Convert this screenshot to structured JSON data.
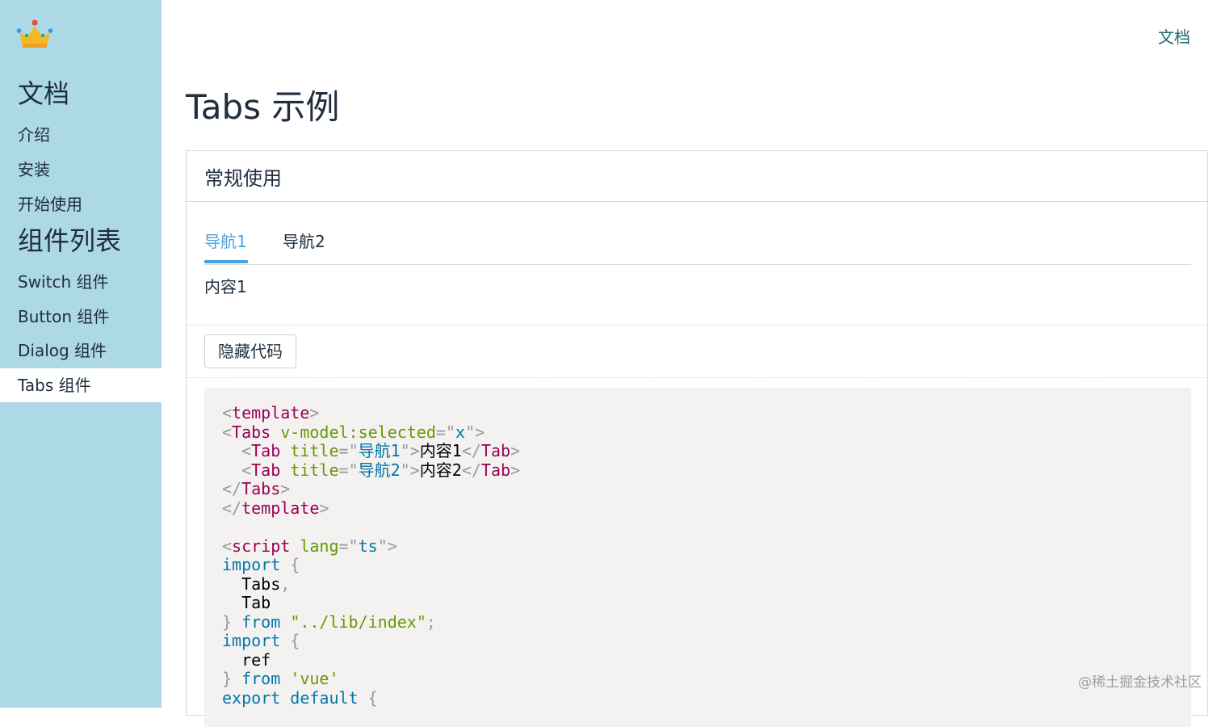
{
  "sidebar": {
    "logo_icon": "crown-icon",
    "sections": [
      {
        "title": "文档",
        "items": [
          "介绍",
          "安装",
          "开始使用"
        ]
      },
      {
        "title": "组件列表",
        "items": [
          "Switch 组件",
          "Button 组件",
          "Dialog 组件",
          "Tabs 组件"
        ]
      }
    ],
    "active_item": "Tabs 组件"
  },
  "topnav": {
    "doc_link": "文档"
  },
  "main": {
    "title": "Tabs 示例",
    "demo": {
      "title": "常规使用",
      "tabs": [
        "导航1",
        "导航2"
      ],
      "selected_tab": "导航1",
      "content": "内容1",
      "toggle_code_label": "隐藏代码"
    }
  },
  "code": {
    "language": "vue",
    "lines": [
      "<template>",
      "<Tabs v-model:selected=\"x\">",
      "  <Tab title=\"导航1\">内容1</Tab>",
      "  <Tab title=\"导航2\">内容2</Tab>",
      "</Tabs>",
      "</template>",
      "",
      "<script lang=\"ts\">",
      "import {",
      "  Tabs,",
      "  Tab",
      "} from \"../lib/index\";",
      "import {",
      "  ref",
      "} from 'vue'",
      "export default {"
    ]
  },
  "watermark": "@稀土掘金技术社区",
  "colors": {
    "sidebar_bg": "#add8e6",
    "accent": "#4aa3df",
    "doc_link": "#1a6b6b",
    "code_bg": "#f4f2f0"
  }
}
